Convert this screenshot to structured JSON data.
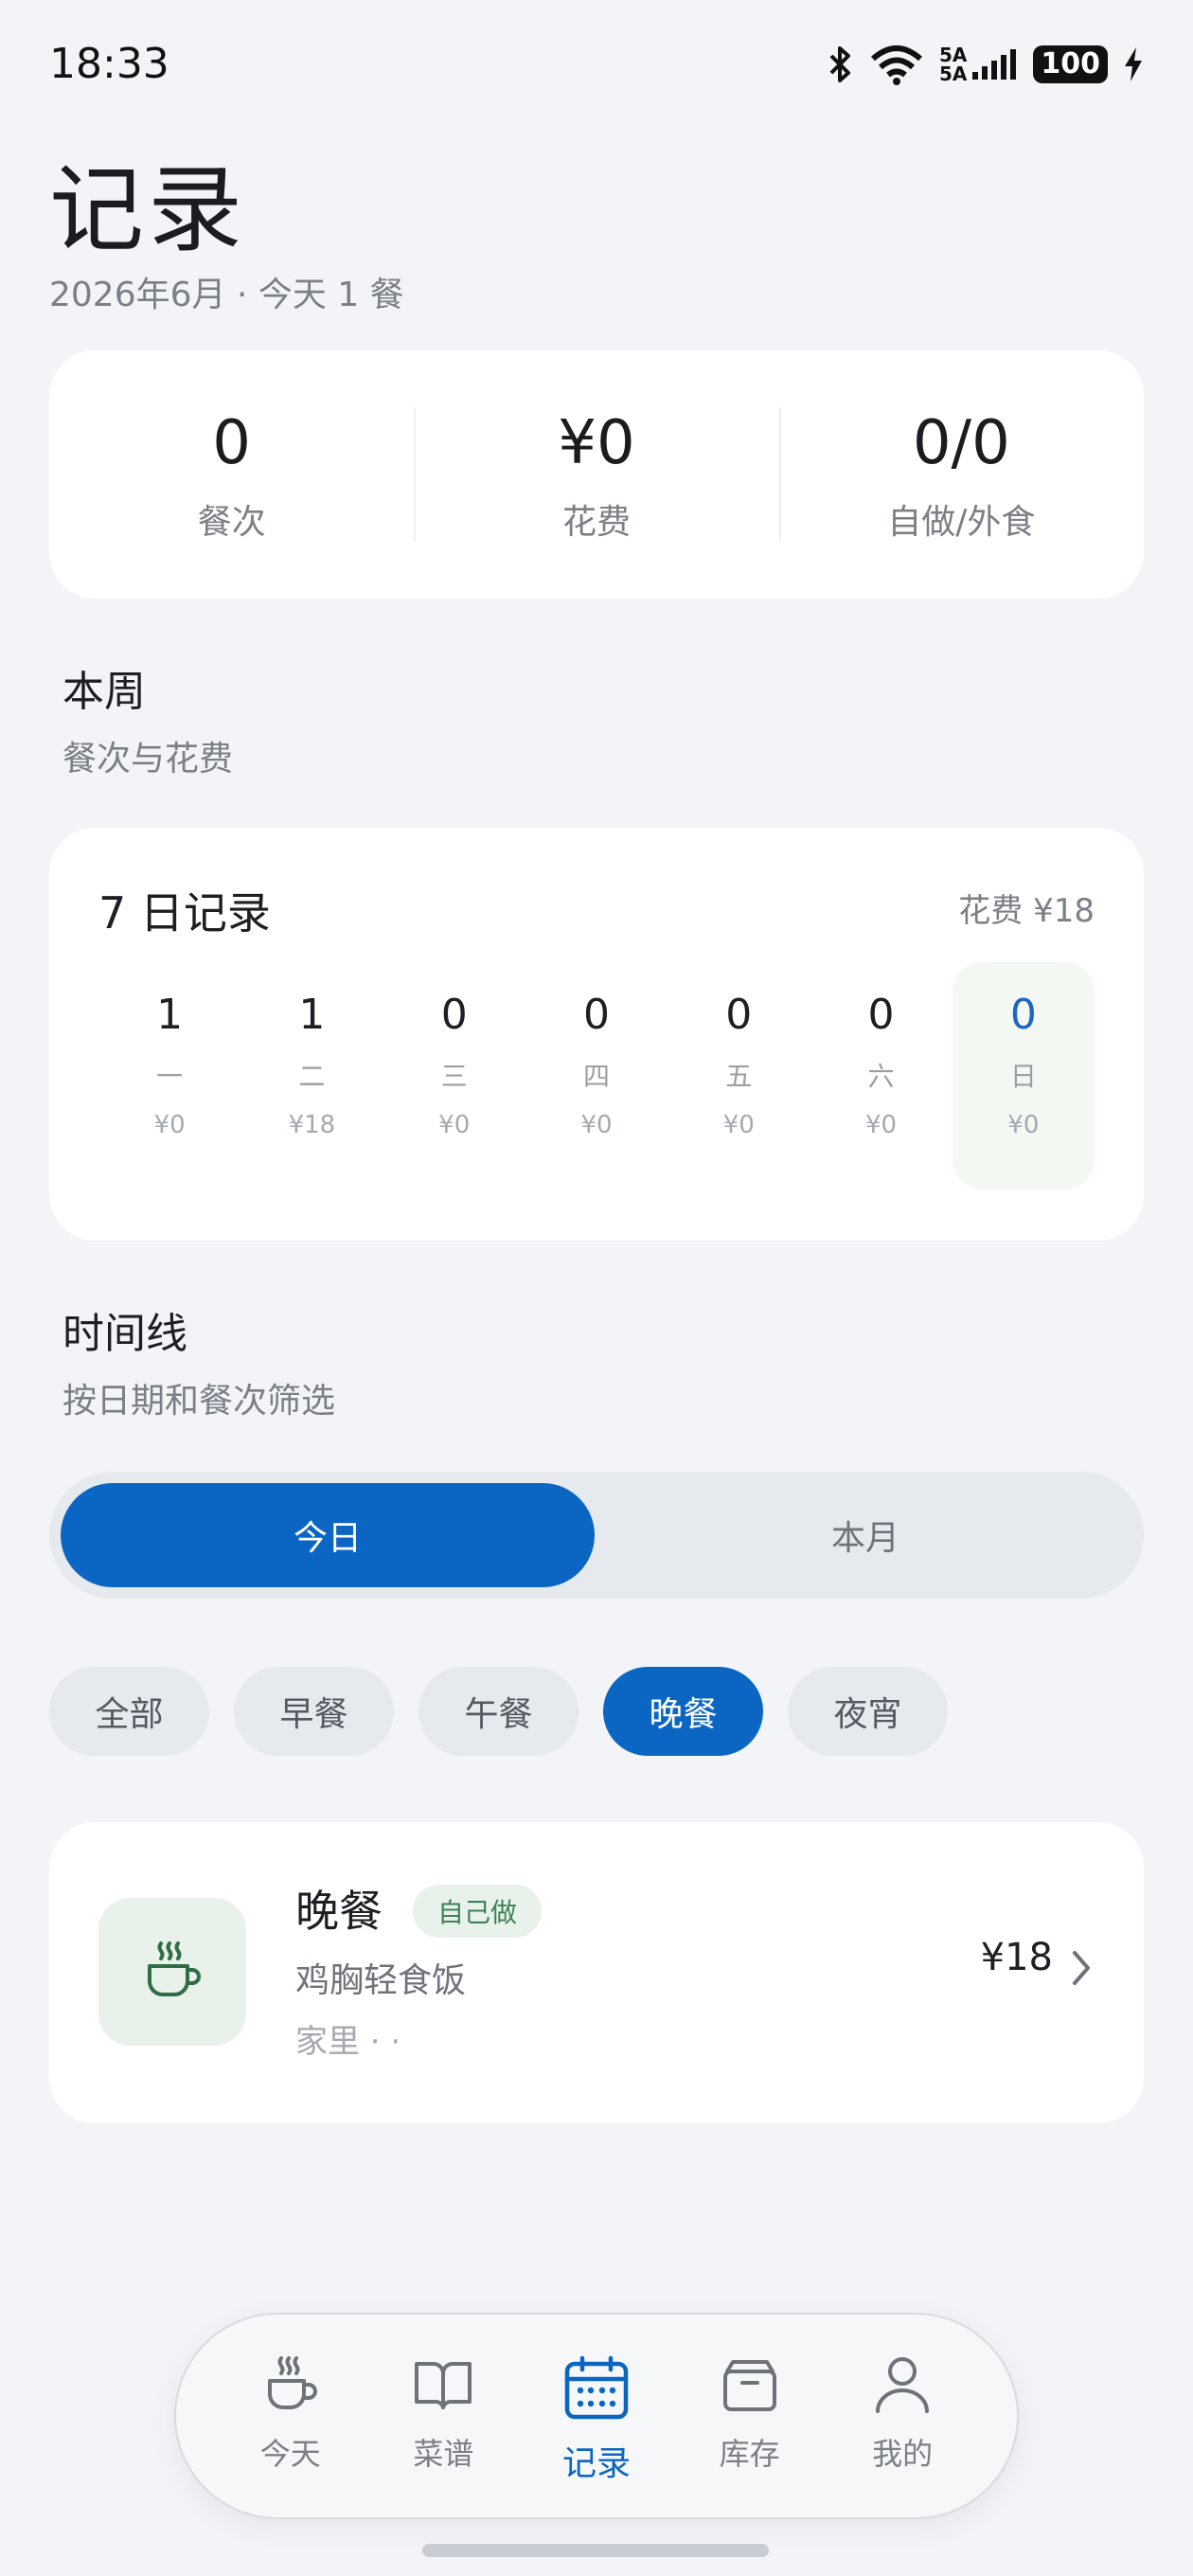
{
  "status_bar": {
    "time": "18:33",
    "network": "5A",
    "battery": "100"
  },
  "header": {
    "title": "记录",
    "subtitle": "2026年6月 · 今天 1 餐"
  },
  "summary": [
    {
      "value": "0",
      "label": "餐次"
    },
    {
      "value": "¥0",
      "label": "花费"
    },
    {
      "value": "0/0",
      "label": "自做/外食"
    }
  ],
  "week_section": {
    "title": "本周",
    "subtitle": "餐次与花费"
  },
  "week_card": {
    "title": "7 日记录",
    "spend": "花费 ¥18",
    "days": [
      {
        "count": "1",
        "name": "一",
        "cost": "¥0"
      },
      {
        "count": "1",
        "name": "二",
        "cost": "¥18"
      },
      {
        "count": "0",
        "name": "三",
        "cost": "¥0"
      },
      {
        "count": "0",
        "name": "四",
        "cost": "¥0"
      },
      {
        "count": "0",
        "name": "五",
        "cost": "¥0"
      },
      {
        "count": "0",
        "name": "六",
        "cost": "¥0"
      },
      {
        "count": "0",
        "name": "日",
        "cost": "¥0"
      }
    ]
  },
  "timeline_section": {
    "title": "时间线",
    "subtitle": "按日期和餐次筛选"
  },
  "segment": {
    "today": "今日",
    "month": "本月"
  },
  "chips": [
    "全部",
    "早餐",
    "午餐",
    "晚餐",
    "夜宵"
  ],
  "meal": {
    "name": "晚餐",
    "tag": "自己做",
    "dish": "鸡胸轻食饭",
    "place": "家里 · ·",
    "price": "¥18"
  },
  "nav": [
    {
      "label": "今天",
      "icon": "cup-icon"
    },
    {
      "label": "菜谱",
      "icon": "book-icon"
    },
    {
      "label": "记录",
      "icon": "calendar-icon"
    },
    {
      "label": "库存",
      "icon": "box-icon"
    },
    {
      "label": "我的",
      "icon": "person-icon"
    }
  ],
  "colors": {
    "accent": "#0b66c3",
    "background": "#f2f4f8",
    "tag_green": "#3f8256"
  }
}
